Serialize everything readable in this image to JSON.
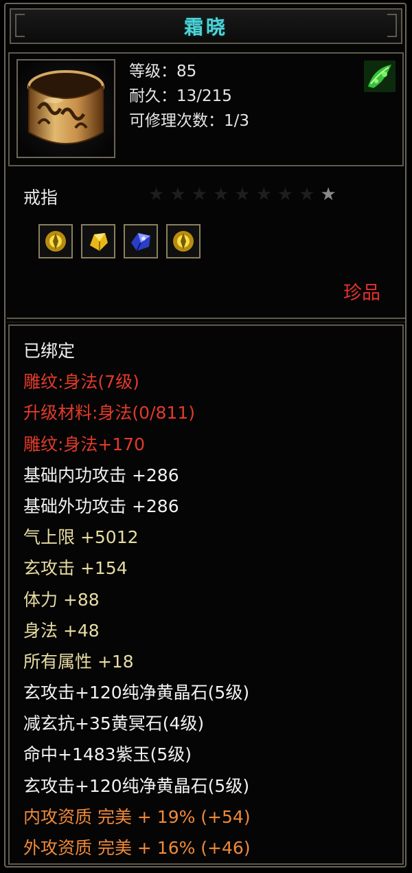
{
  "item": {
    "name": "霜晓",
    "stats": [
      "等级：85",
      "耐久：13/215",
      "可修理次数：1/3"
    ],
    "type": "戒指",
    "stars_total": 9,
    "stars_lit": 1,
    "rarity": "珍品",
    "rarity_color": "#e5322d",
    "gems": [
      "yellow-gem-icon",
      "gold-gem-icon",
      "blue-gem-icon",
      "yellow-gem-icon"
    ]
  },
  "attributes": [
    {
      "text": "已绑定",
      "color": "white"
    },
    {
      "text": "雕纹:身法(7级)",
      "color": "red"
    },
    {
      "text": "升级材料:身法(0/811)",
      "color": "red"
    },
    {
      "text": "雕纹:身法+170",
      "color": "red"
    },
    {
      "text": "基础内功攻击 +286",
      "color": "white"
    },
    {
      "text": "基础外功攻击 +286",
      "color": "white"
    },
    {
      "text": "气上限 +5012",
      "color": "yellow"
    },
    {
      "text": "玄攻击 +154",
      "color": "yellow"
    },
    {
      "text": "体力 +88",
      "color": "yellow"
    },
    {
      "text": "身法 +48",
      "color": "yellow"
    },
    {
      "text": "所有属性 +18",
      "color": "yellow"
    },
    {
      "text": "玄攻击+120纯净黄晶石(5级)",
      "color": "white"
    },
    {
      "text": "减玄抗+35黄冥石(4级)",
      "color": "white"
    },
    {
      "text": "命中+1483紫玉(5级)",
      "color": "white"
    },
    {
      "text": "玄攻击+120纯净黄晶石(5级)",
      "color": "white"
    },
    {
      "text": "内攻资质 完美 + 19% (+54)",
      "color": "orange"
    },
    {
      "text": "外攻资质 完美 + 16% (+46)",
      "color": "orange"
    }
  ],
  "colors": {
    "title": "#4fd3d8",
    "white": "#f2f2f2",
    "red": "#e23a2a",
    "yellow": "#e7dca2",
    "orange": "#f08a3a"
  }
}
